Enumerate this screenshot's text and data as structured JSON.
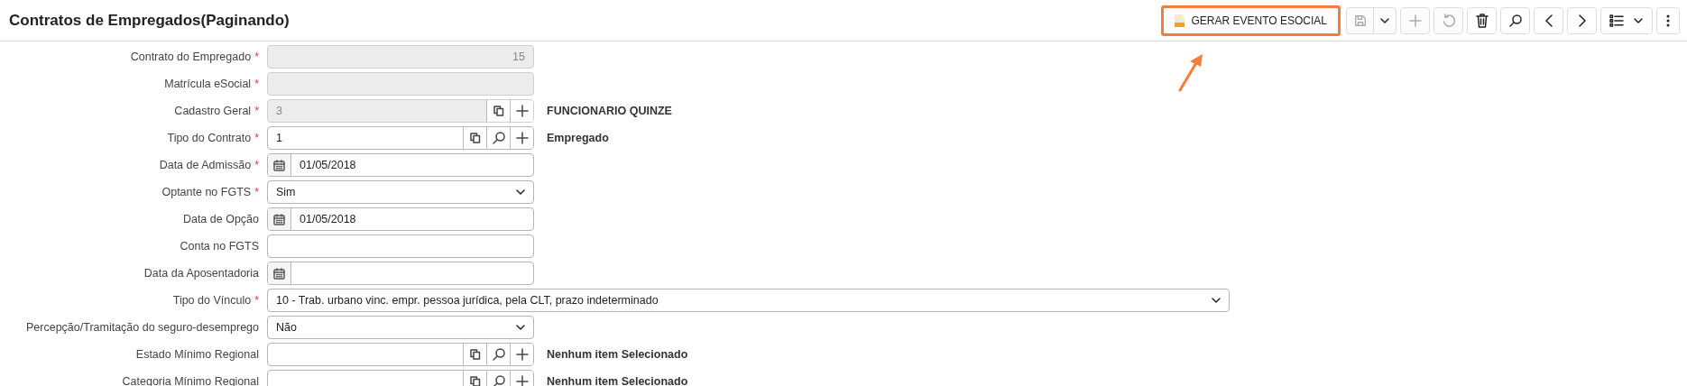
{
  "header": {
    "title": "Contratos de Empregados(Paginando)"
  },
  "toolbar": [
    {
      "kind": "esocial",
      "label": "GERAR EVENTO ESOCIAL",
      "highlighted": true,
      "disabled": false
    },
    {
      "kind": "save",
      "disabled": true
    },
    {
      "kind": "plus",
      "disabled": true
    },
    {
      "kind": "undo",
      "disabled": true
    },
    {
      "kind": "delete",
      "disabled": false
    },
    {
      "kind": "search",
      "disabled": false
    },
    {
      "kind": "prev",
      "disabled": false
    },
    {
      "kind": "next",
      "disabled": false
    },
    {
      "kind": "list",
      "disabled": false
    },
    {
      "kind": "more",
      "disabled": false
    }
  ],
  "form": [
    {
      "label": "Contrato do Empregado",
      "required_mark": "*",
      "kind": "number",
      "disabled": true,
      "value": "15"
    },
    {
      "label": "Matrícula eSocial",
      "required_mark": "*",
      "kind": "text",
      "disabled": true
    },
    {
      "label": "Cadastro Geral",
      "required_mark": "*",
      "kind": "lookup",
      "disabled": true,
      "value": "3",
      "tools": [
        {
          "kind": "copy"
        },
        {
          "kind": "plus"
        }
      ],
      "side_text": "FUNCIONARIO QUINZE"
    },
    {
      "label": "Tipo do Contrato",
      "required_mark": "*",
      "kind": "lookup",
      "disabled": false,
      "value": "1",
      "tools": [
        {
          "kind": "copy"
        },
        {
          "kind": "search"
        },
        {
          "kind": "plus"
        }
      ],
      "side_text": "Empregado"
    },
    {
      "label": "Data de Admissão",
      "required_mark": "*",
      "kind": "date",
      "disabled": false,
      "value": "01/05/2018"
    },
    {
      "label": "Optante no FGTS",
      "required_mark": "*",
      "kind": "select",
      "disabled": false,
      "value": "Sim"
    },
    {
      "label": "Data de Opção",
      "kind": "date",
      "disabled": false,
      "value": "01/05/2018"
    },
    {
      "label": "Conta no FGTS",
      "kind": "text",
      "disabled": false
    },
    {
      "label": "Data da Aposentadoria",
      "kind": "date",
      "disabled": false
    },
    {
      "label": "Tipo do Vínculo",
      "required_mark": "*",
      "kind": "select",
      "wide": true,
      "disabled": false,
      "value": "10 - Trab. urbano vinc. empr. pessoa jurídica, pela CLT, prazo indeterminado"
    },
    {
      "label": "Percepção/Tramitação do seguro-desemprego",
      "kind": "select",
      "disabled": false,
      "value": "Não"
    },
    {
      "label": "Estado Mínimo Regional",
      "kind": "lookup",
      "disabled": false,
      "tools": [
        {
          "kind": "copy"
        },
        {
          "kind": "search"
        },
        {
          "kind": "plus"
        }
      ],
      "side_text": "Nenhum item Selecionado"
    },
    {
      "label": "Categoria Mínimo Regional",
      "kind": "lookup",
      "disabled": false,
      "tools": [
        {
          "kind": "copy"
        },
        {
          "kind": "search"
        },
        {
          "kind": "plus"
        }
      ],
      "side_text": "Nenhum item Selecionado"
    }
  ]
}
